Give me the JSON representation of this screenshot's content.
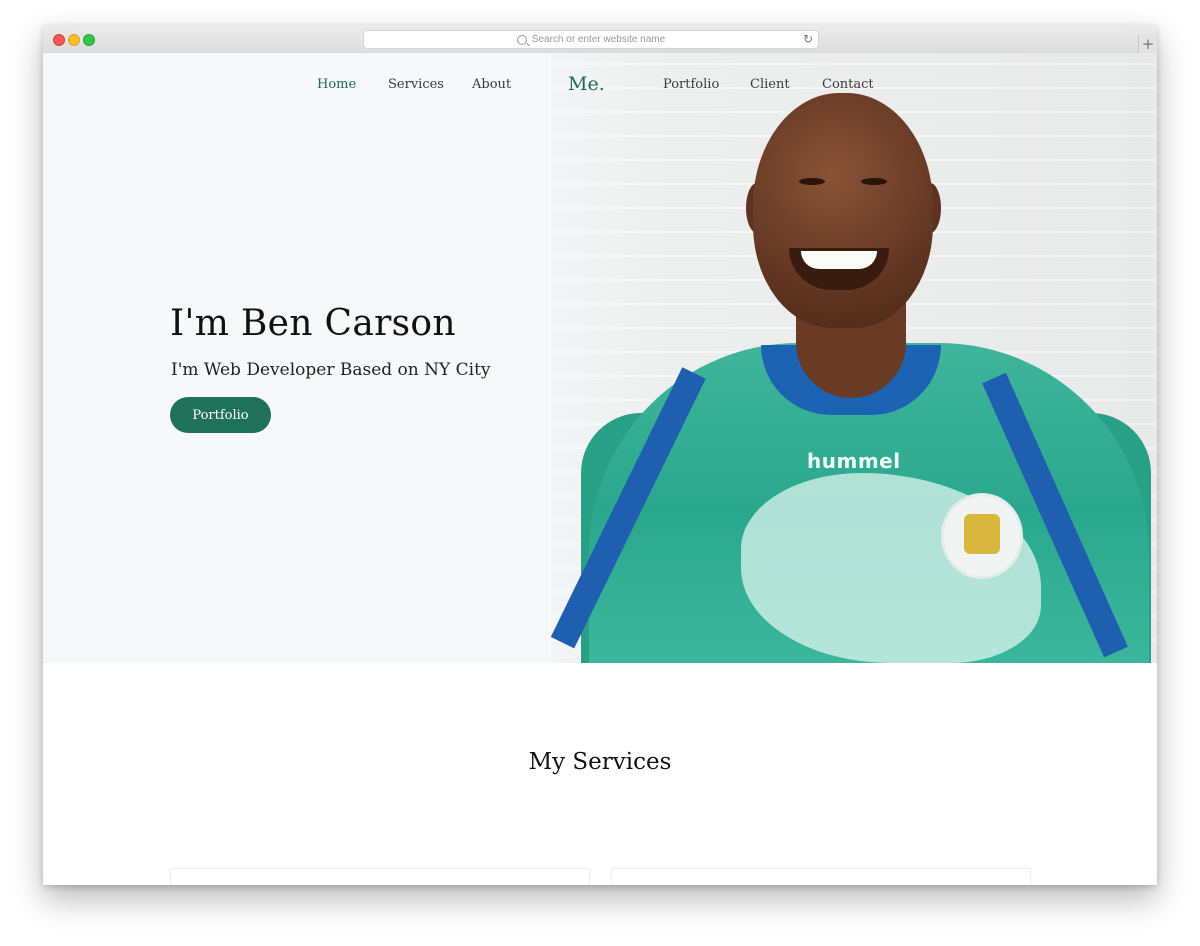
{
  "browser": {
    "address_placeholder": "Search or enter website name",
    "reload_icon": "reload-icon",
    "newtab_label": "+"
  },
  "nav": {
    "items": [
      {
        "label": "Home",
        "active": true
      },
      {
        "label": "Services",
        "active": false
      },
      {
        "label": "About",
        "active": false
      },
      {
        "label": "Portfolio",
        "active": false
      },
      {
        "label": "Client",
        "active": false
      },
      {
        "label": "Contact",
        "active": false
      }
    ],
    "logo": "Me."
  },
  "hero": {
    "title": "I'm Ben Carson",
    "subtitle": "I'm Web Developer Based on NY City",
    "button_label": "Portfolio",
    "shirt_brand": "hummel"
  },
  "services": {
    "title": "My Services"
  },
  "colors": {
    "accent": "#1f7158",
    "hero_background": "#f7f8f9"
  }
}
